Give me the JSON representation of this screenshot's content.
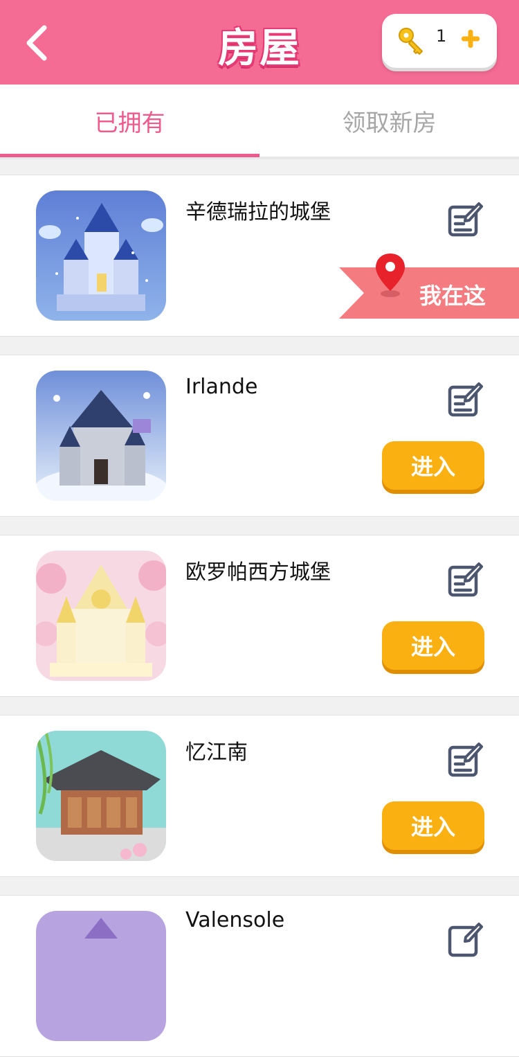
{
  "header": {
    "title": "房屋",
    "key_count": "1",
    "colors": {
      "header_bg": "#f46b93",
      "accent": "#ee5a8c",
      "button": "#fbb012"
    }
  },
  "tabs": [
    {
      "label": "已拥有",
      "active": true
    },
    {
      "label": "领取新房",
      "active": false
    }
  ],
  "houses": [
    {
      "name": "辛德瑞拉的城堡",
      "status": "我在这"
    },
    {
      "name": "Irlande",
      "button": "进入"
    },
    {
      "name": "欧罗帕西方城堡",
      "button": "进入"
    },
    {
      "name": "忆江南",
      "button": "进入"
    },
    {
      "name": "Valensole"
    }
  ]
}
